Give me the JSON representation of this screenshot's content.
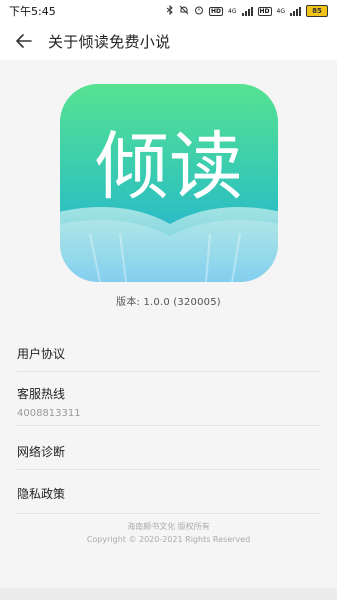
{
  "status_bar": {
    "time": "下午5:45",
    "network_4g_1": "4G",
    "network_4g_2": "4G",
    "hd_1": "HD",
    "hd_2": "HD",
    "battery": "85"
  },
  "header": {
    "title": "关于倾读免费小说",
    "back_icon": "back-arrow-icon"
  },
  "logo": {
    "text": "倾读",
    "colors": {
      "top": "#52e08e",
      "bottom": "#1ea9e0",
      "text": "#ffffff"
    }
  },
  "version_text": "版本: 1.0.0 (320005)",
  "menu": {
    "items": [
      {
        "label": "用户协议"
      },
      {
        "label": "客服热线",
        "sub": "4008813311"
      },
      {
        "label": "网络诊断"
      },
      {
        "label": "隐私政策"
      }
    ]
  },
  "footer": {
    "line1": "海南颇书文化 版权所有",
    "line2": "Copyright © 2020-2021 Rights Reserved"
  }
}
